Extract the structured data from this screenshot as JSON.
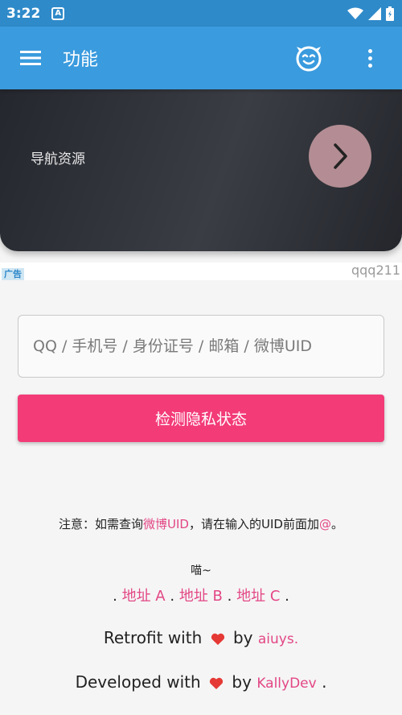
{
  "status_bar": {
    "time": "3:22",
    "notification_icon_text": "A"
  },
  "appbar": {
    "title": "功能"
  },
  "hero": {
    "label": "导航资源"
  },
  "ad": {
    "badge": "广告",
    "text": "qqq211"
  },
  "search": {
    "placeholder": "QQ / 手机号 / 身份证号 / 邮箱 / 微博UID",
    "value": ""
  },
  "check_button": {
    "label": "检测隐私状态"
  },
  "note": {
    "prefix": "注意：如需查询",
    "highlight1": "微博UID",
    "middle": "，请在输入的UID前面加",
    "highlight2": "@",
    "suffix": "。"
  },
  "meow": "喵~",
  "links": {
    "sep": ".",
    "a": "地址 A",
    "b": "地址 B",
    "c": "地址 C"
  },
  "credits": {
    "retrofit_prefix": "Retrofit with",
    "retrofit_by": "by",
    "retrofit_author": "aiuys.",
    "developed_prefix": "Developed with",
    "developed_by": "by",
    "developed_author": "KallyDev",
    "developed_suffix": "."
  },
  "colors": {
    "status_bar": "#2f8ac9",
    "appbar": "#3a9bde",
    "accent_pink": "#f33b78",
    "link_pink": "#e34785",
    "heart": "#e53935"
  },
  "icons": [
    "menu-icon",
    "smiley-face-icon",
    "more-vert-icon",
    "chevron-right-icon",
    "heart-icon",
    "wifi-icon",
    "signal-icon",
    "battery-icon"
  ]
}
